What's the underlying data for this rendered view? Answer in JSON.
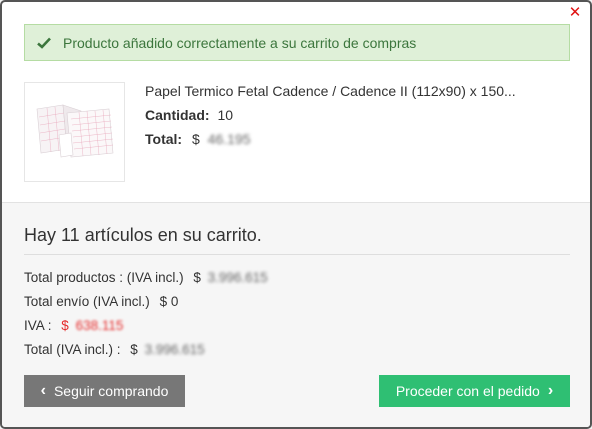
{
  "modal": {
    "alert_message": "Producto añadido correctamente a su carrito de compras"
  },
  "product": {
    "name": "Papel Termico Fetal Cadence / Cadence II (112x90) x 150...",
    "quantity_label": "Cantidad:",
    "quantity_value": "10",
    "total_label": "Total:",
    "total_currency": "$",
    "total_value": "46.195"
  },
  "cart": {
    "count_text": "Hay 11 artículos en su carrito.",
    "products_label": "Total productos : (IVA incl.)",
    "products_currency": "$",
    "products_value": "3.996.615",
    "shipping_label": "Total envío (IVA incl.)",
    "shipping_value": "$ 0",
    "iva_label": "IVA :",
    "iva_currency": "$",
    "iva_value": "638.115",
    "total_label": "Total (IVA incl.) :",
    "total_currency": "$",
    "total_value": "3.996.615"
  },
  "buttons": {
    "continue": "Seguir comprando",
    "checkout": "Proceder con el pedido"
  },
  "colors": {
    "success_bg": "#dff0d8",
    "success_text": "#3c763d",
    "checkout_btn": "#2fbf73",
    "continue_btn": "#777777",
    "close_icon": "#e01212",
    "iva_value": "#e52b2b"
  }
}
